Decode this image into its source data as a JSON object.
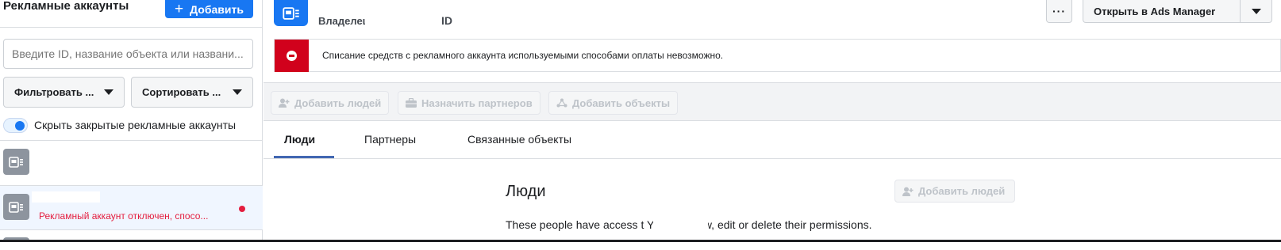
{
  "sidebar": {
    "title": "Рекламные аккаунты",
    "add_button": "Добавить",
    "search_placeholder": "Введите ID, название объекта или названи...",
    "filter_label": "Фильтровать ...",
    "sort_label": "Сортировать ...",
    "hide_closed_label": "Скрыть закрытые рекламные аккаунты",
    "hide_closed_on": true,
    "selected_account_status": "Рекламный аккаунт отключен, спосо..."
  },
  "header": {
    "owner_label": "Владелец",
    "id_label": "ID",
    "more_label": "···",
    "open_ads_manager": "Открыть в Ads Manager"
  },
  "alert": {
    "text": "Списание средств с рекламного аккаунта используемыми способами оплаты невозможно."
  },
  "toolbar": {
    "add_people": "Добавить людей",
    "assign_partners": "Назначить партнеров",
    "add_objects": "Добавить объекты"
  },
  "tabs": [
    {
      "label": "Люди",
      "active": true
    },
    {
      "label": "Партнеры",
      "active": false
    },
    {
      "label": "Связанные объекты",
      "active": false
    }
  ],
  "people_section": {
    "title": "Люди",
    "add_people": "Добавить людей",
    "description": "These people have access t              You can view, edit or delete their permissions."
  },
  "colors": {
    "brand": "#1877f2",
    "alert": "#d1011c",
    "error_text": "#e41e3f",
    "tab_underline": "#4267b2"
  }
}
